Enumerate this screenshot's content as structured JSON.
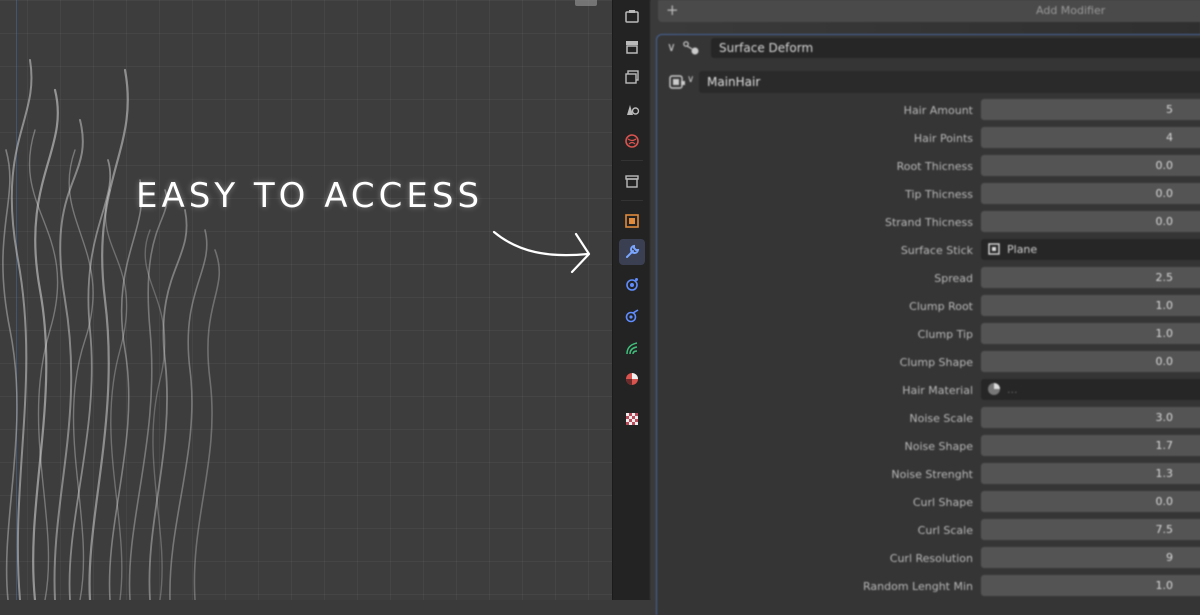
{
  "headline": "EASY TO ACCESS",
  "add_modifier": {
    "plus": "+",
    "label": "Add Modifier"
  },
  "modifier": {
    "name": "Surface Deform",
    "expand_glyph": "∨"
  },
  "node_group": {
    "name": "MainHair"
  },
  "tabs": [
    {
      "name": "tool-icon",
      "active": false
    },
    {
      "name": "render-icon",
      "active": false
    },
    {
      "name": "output-icon",
      "active": false
    },
    {
      "name": "view-layer-icon",
      "active": false
    },
    {
      "name": "scene-icon",
      "active": false
    },
    {
      "name": "world-icon",
      "active": false
    },
    {
      "name": "collection-icon",
      "active": false
    },
    {
      "name": "object-icon",
      "active": false
    },
    {
      "name": "modifier-wrench-icon",
      "active": true
    },
    {
      "name": "particles-icon",
      "active": false
    },
    {
      "name": "physics-icon",
      "active": false
    },
    {
      "name": "object-constraint-icon",
      "active": false
    },
    {
      "name": "object-data-icon",
      "active": false
    },
    {
      "name": "material-icon",
      "active": false
    },
    {
      "name": "texture-icon",
      "active": false
    }
  ],
  "properties": [
    {
      "label": "Hair Amount",
      "value": "5"
    },
    {
      "label": "Hair Points",
      "value": "4"
    },
    {
      "label": "Root Thicness",
      "value": "0.0"
    },
    {
      "label": "Tip Thicness",
      "value": "0.0"
    },
    {
      "label": "Strand Thicness",
      "value": "0.0"
    },
    {
      "label": "Surface Stick",
      "ref": "Plane",
      "ref_icon": "mesh-object-icon"
    },
    {
      "label": "Spread",
      "value": "2.5"
    },
    {
      "label": "Clump Root",
      "value": "1.0"
    },
    {
      "label": "Clump Tip",
      "value": "1.0"
    },
    {
      "label": "Clump Shape",
      "value": "0.0"
    },
    {
      "label": "Hair Material",
      "ref": "...",
      "ref_icon": "material-sphere-icon"
    },
    {
      "label": "Noise Scale",
      "value": "3.0"
    },
    {
      "label": "Noise Shape",
      "value": "1.7"
    },
    {
      "label": "Noise Strenght",
      "value": "1.3"
    },
    {
      "label": "Curl Shape",
      "value": "0.0"
    },
    {
      "label": "Curl Scale",
      "value": "7.5"
    },
    {
      "label": "Curl Resolution",
      "value": "9"
    },
    {
      "label": "Random Lenght Min",
      "value": "1.0"
    }
  ],
  "colors": {
    "accent_blue": "#47649a",
    "wrench_blue": "#7aa6ff",
    "object_orange": "#e08a3c",
    "physics_blue": "#5f8cff",
    "constraint_green": "#3fbf7a",
    "material_red": "#d9534f"
  }
}
